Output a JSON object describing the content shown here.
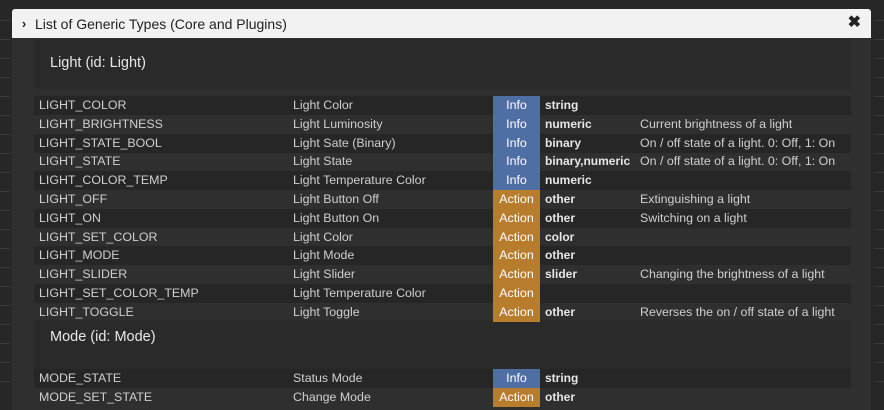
{
  "dialog": {
    "title": "List of Generic Types (Core and Plugins)",
    "close_glyph": "✖",
    "chevron_glyph": "›"
  },
  "colors": {
    "info": "#4f6fa4",
    "action": "#b77d2c",
    "titlebar": "#f2f2f2"
  },
  "sections": [
    {
      "title": "Light (id: Light)",
      "rows": [
        {
          "id": "LIGHT_COLOR",
          "name": "Light Color",
          "type": "Info",
          "dtype": "string",
          "desc": ""
        },
        {
          "id": "LIGHT_BRIGHTNESS",
          "name": "Light Luminosity",
          "type": "Info",
          "dtype": "numeric",
          "desc": "Current brightness of a light"
        },
        {
          "id": "LIGHT_STATE_BOOL",
          "name": "Light Sate (Binary)",
          "type": "Info",
          "dtype": "binary",
          "desc": "On / off state of a light. 0: Off, 1: On"
        },
        {
          "id": "LIGHT_STATE",
          "name": "Light State",
          "type": "Info",
          "dtype": "binary,numeric",
          "desc": "On / off state of a light. 0: Off, 1: On"
        },
        {
          "id": "LIGHT_COLOR_TEMP",
          "name": "Light Temperature Color",
          "type": "Info",
          "dtype": "numeric",
          "desc": ""
        },
        {
          "id": "LIGHT_OFF",
          "name": "Light Button Off",
          "type": "Action",
          "dtype": "other",
          "desc": "Extinguishing a light"
        },
        {
          "id": "LIGHT_ON",
          "name": "Light Button On",
          "type": "Action",
          "dtype": "other",
          "desc": "Switching on a light"
        },
        {
          "id": "LIGHT_SET_COLOR",
          "name": "Light Color",
          "type": "Action",
          "dtype": "color",
          "desc": ""
        },
        {
          "id": "LIGHT_MODE",
          "name": "Light Mode",
          "type": "Action",
          "dtype": "other",
          "desc": ""
        },
        {
          "id": "LIGHT_SLIDER",
          "name": "Light Slider",
          "type": "Action",
          "dtype": "slider",
          "desc": "Changing the brightness of a light"
        },
        {
          "id": "LIGHT_SET_COLOR_TEMP",
          "name": "Light Temperature Color",
          "type": "Action",
          "dtype": "",
          "desc": ""
        },
        {
          "id": "LIGHT_TOGGLE",
          "name": "Light Toggle",
          "type": "Action",
          "dtype": "other",
          "desc": "Reverses the on / off state of a light"
        }
      ]
    },
    {
      "title": "Mode (id: Mode)",
      "rows": [
        {
          "id": "MODE_STATE",
          "name": "Status Mode",
          "type": "Info",
          "dtype": "string",
          "desc": ""
        },
        {
          "id": "MODE_SET_STATE",
          "name": "Change Mode",
          "type": "Action",
          "dtype": "other",
          "desc": ""
        }
      ]
    }
  ]
}
